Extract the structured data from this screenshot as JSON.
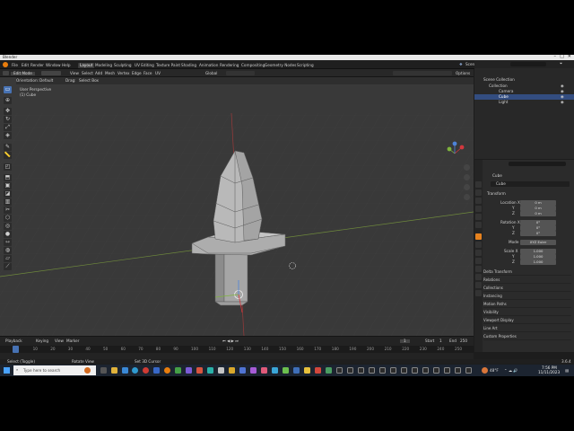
{
  "window": {
    "title": "Blender"
  },
  "menus": [
    "File",
    "Edit",
    "Render",
    "Window",
    "Help"
  ],
  "workspaces": [
    "Layout",
    "Modeling",
    "Sculpting",
    "UV Editing",
    "Texture Paint",
    "Shading",
    "Animation",
    "Rendering",
    "Compositing",
    "Geometry Nodes",
    "Scripting"
  ],
  "active_workspace": "Layout",
  "scene": {
    "scene_name": "Scene",
    "view_layer": "ViewLayer"
  },
  "viewport_header": {
    "mode": "Edit Mode",
    "menus": [
      "View",
      "Select",
      "Add",
      "Mesh",
      "Vertex",
      "Edge",
      "Face",
      "UV"
    ],
    "transform_orientation": "Global",
    "options": "Options"
  },
  "viewport_sub": {
    "orientation_label": "Orientation:",
    "orientation_value": "Default",
    "drag_label": "Drag:",
    "drag_value": "Select Box"
  },
  "viewport_overlay": {
    "view_name": "User Perspective",
    "object_name": "(1) Cube"
  },
  "outliner": {
    "root": "Scene Collection",
    "items": [
      {
        "label": "Collection",
        "depth": 1
      },
      {
        "label": "Camera",
        "depth": 2
      },
      {
        "label": "Cube",
        "depth": 2,
        "selected": true
      },
      {
        "label": "Light",
        "depth": 2
      }
    ]
  },
  "properties": {
    "object_name": "Cube",
    "datablock": "Cube",
    "transform_label": "Transform",
    "location_label": "Location X",
    "location": [
      "0 m",
      "0 m",
      "0 m"
    ],
    "rotation_label": "Rotation X",
    "rotation": [
      "0°",
      "0°",
      "0°"
    ],
    "axis_labels": [
      "Y",
      "Z"
    ],
    "mode_label": "Mode",
    "mode_value": "XYZ Euler",
    "scale_label": "Scale X",
    "scale": [
      "1.000",
      "1.000",
      "1.000"
    ],
    "sections": [
      "Delta Transform",
      "Relations",
      "Collections",
      "Instancing",
      "Motion Paths",
      "Visibility",
      "Viewport Display",
      "Line Art",
      "Custom Properties"
    ]
  },
  "timeline": {
    "menus": [
      "Playback",
      "Keying",
      "View",
      "Marker"
    ],
    "current_frame": "1",
    "start_label": "Start",
    "start": "1",
    "end_label": "End",
    "end": "250",
    "ruler": [
      "0",
      "10",
      "20",
      "30",
      "40",
      "50",
      "60",
      "70",
      "80",
      "90",
      "100",
      "110",
      "120",
      "130",
      "140",
      "150",
      "160",
      "170",
      "180",
      "190",
      "200",
      "210",
      "220",
      "230",
      "240",
      "250"
    ]
  },
  "statusbar": {
    "left": "Select (Toggle)",
    "middle": "Rotate View",
    "right": "Set 3D Cursor",
    "version": "3.6.4"
  },
  "taskbar": {
    "search_placeholder": "Type here to search",
    "weather": "48°F",
    "time": "7:56 PM",
    "date": "11/11/2023"
  },
  "colors": {
    "accent": "#4772b3",
    "selected_row": "#334d80",
    "viewport": "#393939",
    "mesh": "#b4b4b4"
  }
}
